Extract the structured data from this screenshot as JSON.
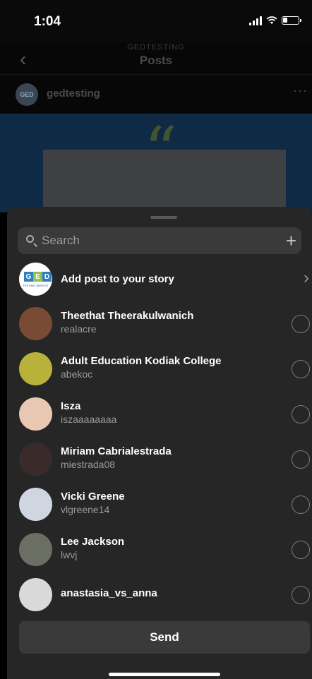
{
  "status_bar": {
    "time": "1:04"
  },
  "nav": {
    "kicker": "GEDTESTING",
    "title": "Posts",
    "back_icon": "chevron-left-icon"
  },
  "post": {
    "username": "gedtesting",
    "avatar_text": "GED"
  },
  "share_sheet": {
    "search": {
      "placeholder": "Search",
      "value": ""
    },
    "story_row": {
      "label": "Add post to your story",
      "avatar_letters": [
        "G",
        "E",
        "D"
      ],
      "avatar_subtext": "TESTING SERVICE"
    },
    "contacts": [
      {
        "name": "Theethat Theerakulwanich",
        "handle": "realacre",
        "avatar_color": "#7a4b34"
      },
      {
        "name": "Adult Education Kodiak College",
        "handle": "abekoc",
        "avatar_color": "#b9b23a"
      },
      {
        "name": "Isza",
        "handle": "iszaaaaaaaa",
        "avatar_color": "#e8c7b3"
      },
      {
        "name": "Miriam Cabrialestrada",
        "handle": "miestrada08",
        "avatar_color": "#3a2a2a"
      },
      {
        "name": "Vicki Greene",
        "handle": "vlgreene14",
        "avatar_color": "#cfd6df"
      },
      {
        "name": "Lee Jackson",
        "handle": "lwvj",
        "avatar_color": "#6b6e62"
      },
      {
        "name": "anastasia_vs_anna",
        "handle": "",
        "avatar_color": "#d9d9d9"
      }
    ],
    "send_label": "Send"
  },
  "colors": {
    "sheet_bg": "#262626",
    "post_bg": "#0f2a44",
    "accent_blue": "#2e7fc0"
  }
}
